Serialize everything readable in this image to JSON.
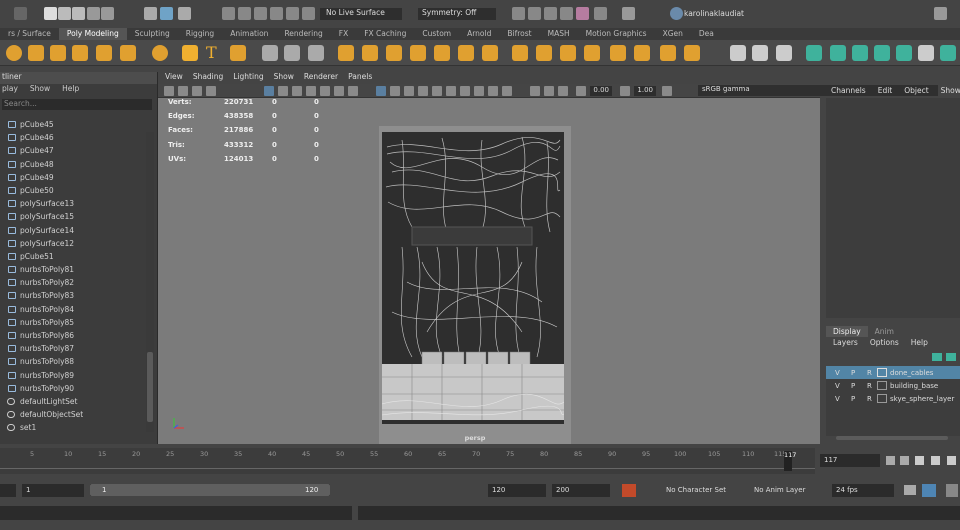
{
  "status_line": {
    "surface_label": "No Live Surface",
    "symmetry_label": "Symmetry: Off",
    "user_name": "karolinaklaudiat"
  },
  "shelf_tabs": [
    "rs / Surface",
    "Poly Modeling",
    "Sculpting",
    "Rigging",
    "Animation",
    "Rendering",
    "FX",
    "FX Caching",
    "Custom",
    "Arnold",
    "Bifrost",
    "MASH",
    "Motion Graphics",
    "XGen",
    "Dea"
  ],
  "outliner": {
    "title": "tliner",
    "menu": [
      "play",
      "Show",
      "Help"
    ],
    "search_placeholder": "Search...",
    "items": [
      "pCube45",
      "pCube46",
      "pCube47",
      "pCube48",
      "pCube49",
      "pCube50",
      "polySurface13",
      "polySurface15",
      "polySurface14",
      "polySurface12",
      "pCube51",
      "nurbsToPoly81",
      "nurbsToPoly82",
      "nurbsToPoly83",
      "nurbsToPoly84",
      "nurbsToPoly85",
      "nurbsToPoly86",
      "nurbsToPoly87",
      "nurbsToPoly88",
      "nurbsToPoly89",
      "nurbsToPoly90",
      "defaultLightSet",
      "defaultObjectSet",
      "set1"
    ]
  },
  "viewport": {
    "menu": [
      "View",
      "Shading",
      "Lighting",
      "Show",
      "Renderer",
      "Panels"
    ],
    "exposure": "0.00",
    "gamma": "1.00",
    "color_space": "sRGB gamma",
    "camera": "persp",
    "hud": [
      {
        "label": "Verts:",
        "v1": "220731",
        "v2": "0",
        "v3": "0"
      },
      {
        "label": "Edges:",
        "v1": "438358",
        "v2": "0",
        "v3": "0"
      },
      {
        "label": "Faces:",
        "v1": "217886",
        "v2": "0",
        "v3": "0"
      },
      {
        "label": "Tris:",
        "v1": "433312",
        "v2": "0",
        "v3": "0"
      },
      {
        "label": "UVs:",
        "v1": "124013",
        "v2": "0",
        "v3": "0"
      }
    ]
  },
  "channel_box": {
    "menu": [
      "Channels",
      "Edit",
      "Object",
      "Show"
    ]
  },
  "layer_editor": {
    "tabs": [
      "Display",
      "Anim"
    ],
    "menu": [
      "Layers",
      "Options",
      "Help"
    ],
    "layers": [
      {
        "v": "V",
        "p": "P",
        "r": "R",
        "name": "done_cables"
      },
      {
        "v": "V",
        "p": "P",
        "r": "R",
        "name": "building_base"
      },
      {
        "v": "V",
        "p": "P",
        "r": "R",
        "name": "skye_sphere_layer"
      }
    ]
  },
  "timeline": {
    "ticks": [
      "5",
      "10",
      "15",
      "20",
      "25",
      "30",
      "35",
      "40",
      "45",
      "50",
      "55",
      "60",
      "65",
      "70",
      "75",
      "80",
      "85",
      "90",
      "95",
      "100",
      "105",
      "110",
      "115"
    ],
    "current_frame": "117",
    "current_frame_field": "117"
  },
  "range_slider": {
    "start_field": "1",
    "inner_start": "1",
    "inner_end": "120",
    "end_field": "120",
    "anim_end": "200",
    "character_set": "No Character Set",
    "anim_layer": "No Anim Layer",
    "fps": "24 fps"
  }
}
